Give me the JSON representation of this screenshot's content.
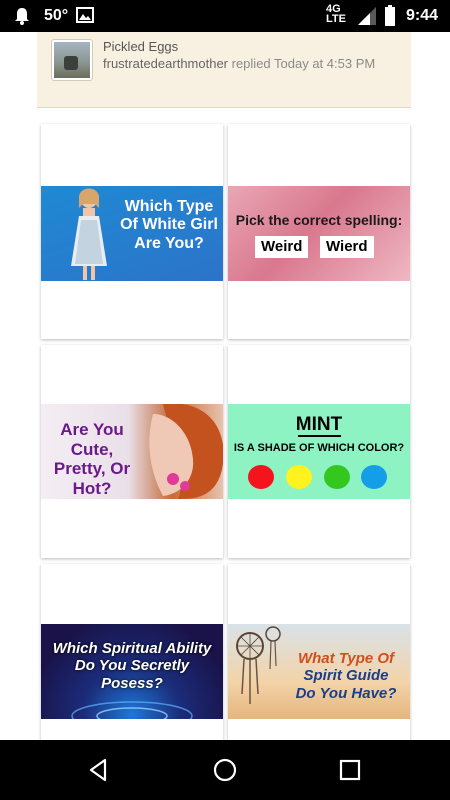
{
  "status_bar": {
    "temperature": "50°",
    "network": "4G LTE",
    "time": "9:44",
    "icons": [
      "notification-bell-icon",
      "image-icon",
      "signal-icon",
      "battery-icon"
    ]
  },
  "topic": {
    "title": "Pickled Eggs",
    "username": "frustratedearthmother",
    "activity": " replied Today at 4:53 PM"
  },
  "ads": {
    "choices_icons": [
      "adchoices-icon",
      "close-icon"
    ],
    "tiles": [
      {
        "text": "Which Type Of White Girl Are You?"
      },
      {
        "heading": "Pick the correct spelling:",
        "options": [
          "Weird",
          "Wierd"
        ]
      },
      {
        "text": "Are You Cute, Pretty, Or Hot?"
      },
      {
        "word": "MINT",
        "question": "IS A SHADE OF WHICH COLOR?",
        "dot_colors": [
          "#f5141e",
          "#fff21f",
          "#34c81f",
          "#159ee8"
        ]
      },
      {
        "text": "Which Spiritual Ability Do You Secretly Posess?"
      },
      {
        "line1": "What Type Of",
        "line2": "Spirit Guide",
        "line3": "Do You Have?"
      }
    ]
  },
  "nav_bar": {
    "buttons": [
      "back-icon",
      "home-icon",
      "recents-icon"
    ]
  },
  "colors": {
    "forum_card_bg": "#f8f1e1",
    "ad_accent": "#1ba3d9"
  }
}
